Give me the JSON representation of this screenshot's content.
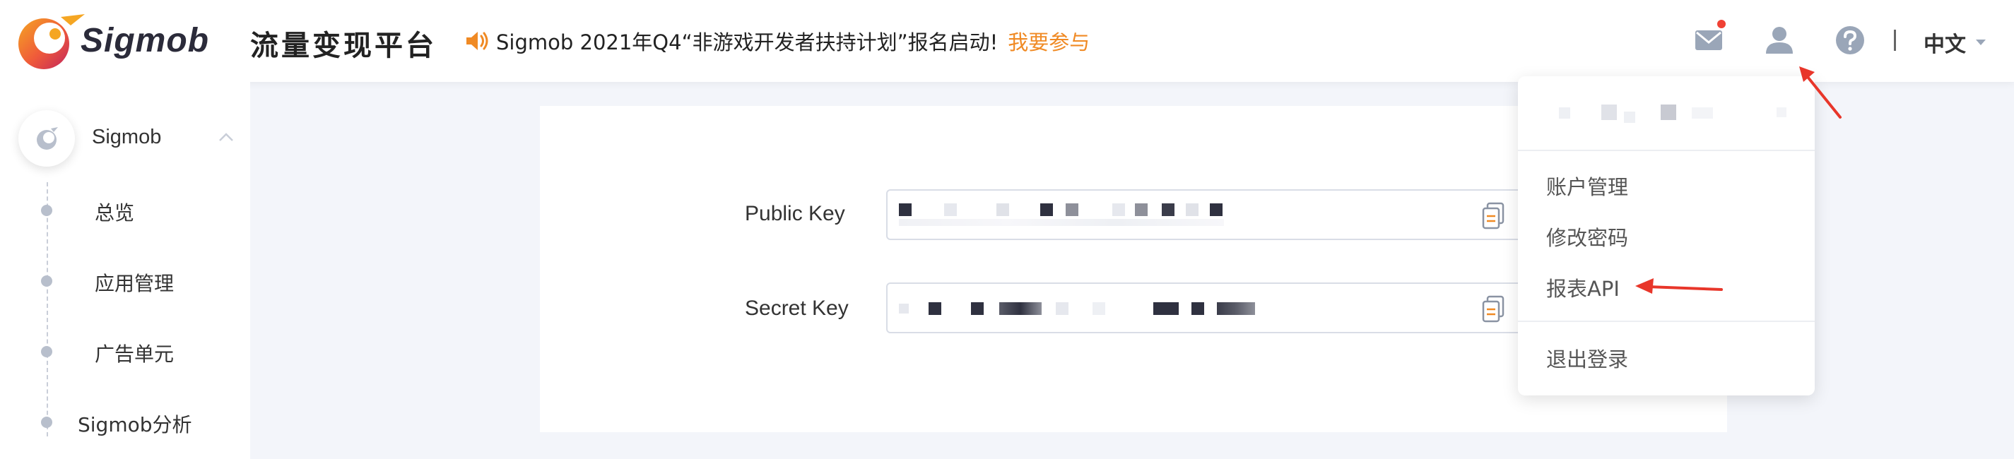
{
  "brand": {
    "logo_text": "Sigmob",
    "platform_title": "流量变现平台"
  },
  "announcement": {
    "text": "Sigmob 2021年Q4“非游戏开发者扶持计划”报名启动!",
    "link_label": "我要参与",
    "icon": "speaker-icon"
  },
  "header": {
    "icons": [
      "mail-icon",
      "user-icon",
      "help-icon"
    ],
    "language": "中文"
  },
  "sidebar": {
    "group_label": "Sigmob",
    "items": [
      {
        "label": "总览"
      },
      {
        "label": "应用管理"
      },
      {
        "label": "广告单元"
      },
      {
        "label": "Sigmob分析"
      }
    ]
  },
  "keys": {
    "public_key_label": "Public Key",
    "secret_key_label": "Secret Key"
  },
  "user_menu": {
    "items": [
      {
        "label": "账户管理"
      },
      {
        "label": "修改密码"
      },
      {
        "label": "报表API"
      },
      {
        "label": "退出登录"
      }
    ]
  },
  "colors": {
    "accent_orange": "#f08a24",
    "annotation_red": "#e8362a",
    "notification_dot": "#f04134"
  }
}
